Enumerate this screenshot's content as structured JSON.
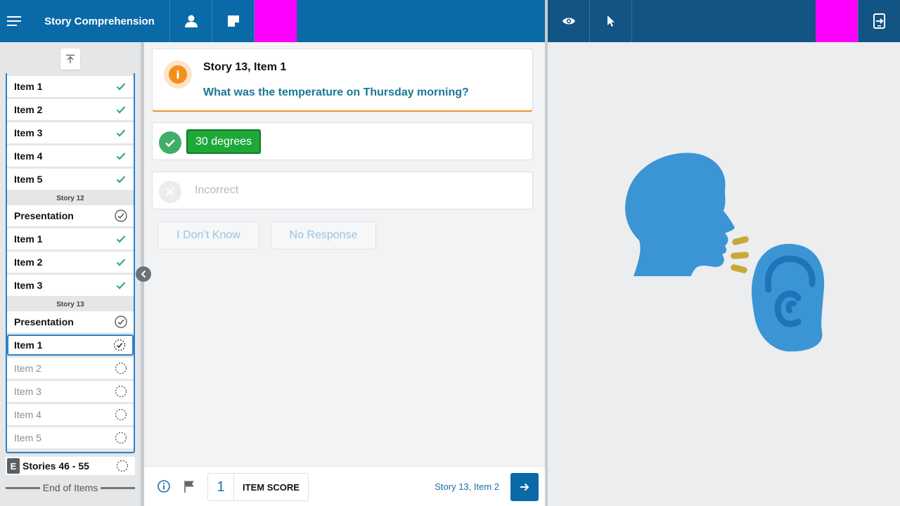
{
  "header": {
    "title": "Story Comprehension",
    "accent_color": "#0a6aa8",
    "right_bar_color": "#125484",
    "placeholder_color": "#ff00ff",
    "icons": [
      "menu-icon",
      "person-icon",
      "note-icon",
      "eye-icon",
      "pointer-icon",
      "screen-exit-icon"
    ]
  },
  "sidebar": {
    "groups_before": [
      {
        "label": "Item 1",
        "status": "check"
      },
      {
        "label": "Item 2",
        "status": "check"
      },
      {
        "label": "Item 3",
        "status": "check"
      },
      {
        "label": "Item 4",
        "status": "check"
      },
      {
        "label": "Item 5",
        "status": "check"
      }
    ],
    "story12": {
      "label": "Story 12",
      "items": [
        {
          "label": "Presentation",
          "status": "circle-check"
        },
        {
          "label": "Item 1",
          "status": "check"
        },
        {
          "label": "Item 2",
          "status": "check"
        },
        {
          "label": "Item 3",
          "status": "check"
        }
      ]
    },
    "story13": {
      "label": "Story 13",
      "items": [
        {
          "label": "Presentation",
          "status": "circle-check"
        },
        {
          "label": "Item 1",
          "status": "current"
        },
        {
          "label": "Item 2",
          "status": "pending"
        },
        {
          "label": "Item 3",
          "status": "pending"
        },
        {
          "label": "Item 4",
          "status": "pending"
        },
        {
          "label": "Item 5",
          "status": "pending"
        }
      ]
    },
    "stories_badge": "E",
    "stories_label": "Stories 46 - 55",
    "end_label": "End of Items"
  },
  "question": {
    "title": "Story 13, Item 1",
    "text": "What was the temperature on Thursday morning?",
    "info_glyph": "i"
  },
  "answers": {
    "correct": "30 degrees",
    "incorrect": "Incorrect",
    "dont_know": "I Don’t Know",
    "no_response": "No Response"
  },
  "footer": {
    "score_value": "1",
    "score_label": "ITEM SCORE",
    "next_item": "Story 13, Item 2"
  },
  "illustration": {
    "name": "speaking-listening-icon",
    "head_color": "#3b95d4",
    "sound_color": "#c9a83a"
  }
}
